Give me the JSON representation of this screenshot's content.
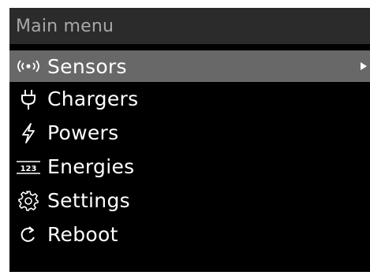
{
  "title": "Main menu",
  "menu": {
    "items": [
      {
        "label": "Sensors",
        "icon": "sensor-broadcast-icon",
        "selected": true,
        "has_submenu": true
      },
      {
        "label": "Chargers",
        "icon": "plug-icon",
        "selected": false
      },
      {
        "label": "Powers",
        "icon": "lightning-icon",
        "selected": false
      },
      {
        "label": "Energies",
        "icon": "counter-123-icon",
        "icon_text": "123",
        "selected": false
      },
      {
        "label": "Settings",
        "icon": "gear-icon",
        "selected": false
      },
      {
        "label": "Reboot",
        "icon": "reboot-icon",
        "selected": false
      }
    ]
  },
  "colors": {
    "background": "#000000",
    "title_bar": "#2b2b2b",
    "title_text": "#a8a8a8",
    "selection": "#686868",
    "text": "#ffffff"
  }
}
